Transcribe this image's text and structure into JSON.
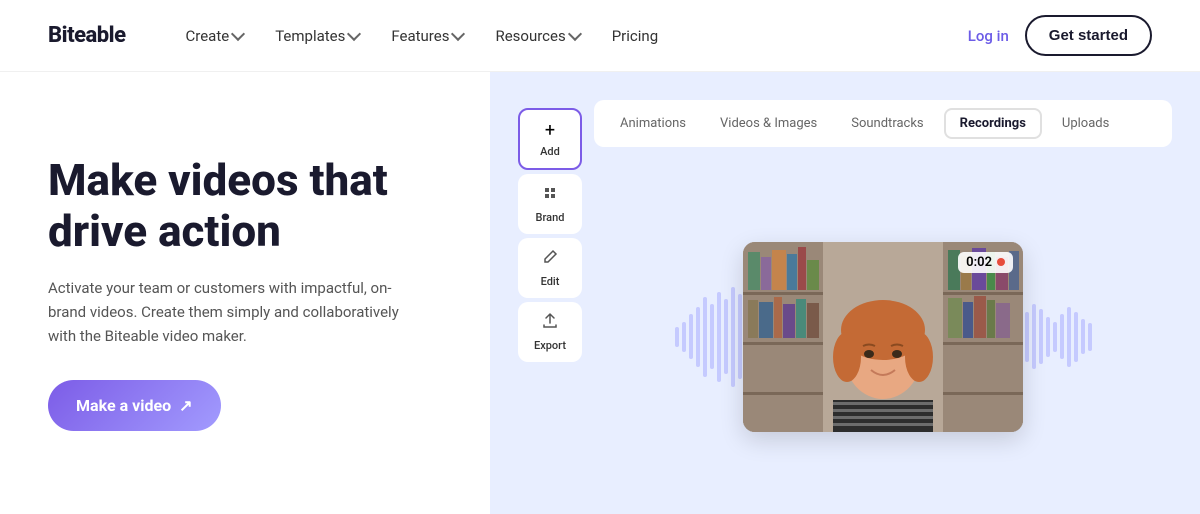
{
  "brand": {
    "name": "Biteable"
  },
  "nav": {
    "items": [
      {
        "label": "Create",
        "hasDropdown": true
      },
      {
        "label": "Templates",
        "hasDropdown": true
      },
      {
        "label": "Features",
        "hasDropdown": true
      },
      {
        "label": "Resources",
        "hasDropdown": true
      },
      {
        "label": "Pricing",
        "hasDropdown": false
      }
    ],
    "login_label": "Log in",
    "get_started_label": "Get started"
  },
  "hero": {
    "title": "Make videos that drive action",
    "subtitle": "Activate your team or customers with impactful, on-brand videos. Create them simply and collaboratively with the Biteable video maker.",
    "cta_label": "Make a video"
  },
  "editor": {
    "tools": [
      {
        "label": "Add",
        "icon": "+"
      },
      {
        "label": "Brand",
        "icon": "✦"
      },
      {
        "label": "Edit",
        "icon": "✎"
      },
      {
        "label": "Export",
        "icon": "↗"
      }
    ],
    "tabs": [
      {
        "label": "Animations"
      },
      {
        "label": "Videos & Images"
      },
      {
        "label": "Soundtracks"
      },
      {
        "label": "Recordings",
        "active": true
      },
      {
        "label": "Uploads"
      }
    ],
    "timer": "0:02"
  }
}
